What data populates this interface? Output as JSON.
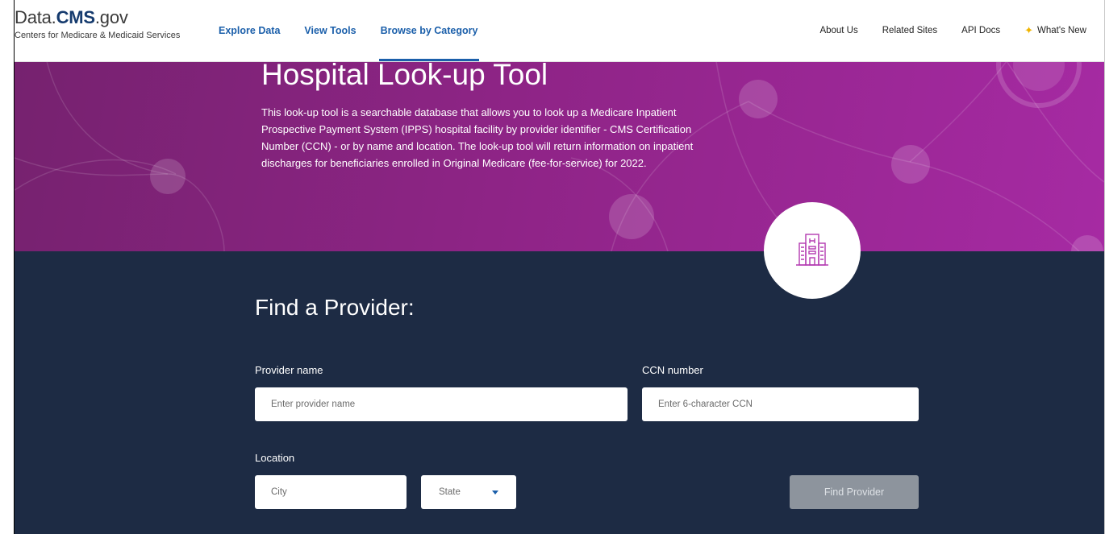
{
  "header": {
    "logo": {
      "prefix": "Data.",
      "brand": "CMS",
      "suffix": ".gov",
      "subtitle": "Centers for Medicare & Medicaid Services"
    },
    "nav": [
      {
        "label": "Explore Data",
        "active": false
      },
      {
        "label": "View Tools",
        "active": false
      },
      {
        "label": "Browse by Category",
        "active": true
      }
    ],
    "utility": [
      {
        "label": "About Us"
      },
      {
        "label": "Related Sites"
      },
      {
        "label": "API Docs"
      },
      {
        "label": "What's New",
        "icon": "sparkle-icon"
      }
    ]
  },
  "hero": {
    "title": "Hospital Look-up Tool",
    "description": "This look-up tool is a searchable database that allows you to look up a Medicare Inpatient Prospective Payment System (IPPS) hospital facility by provider identifier - CMS Certification Number (CCN) - or by name and location. The look-up tool will return information on inpatient discharges for beneficiaries enrolled in Original Medicare (fee-for-service) for 2022.",
    "badge_icon": "hospital-building-icon"
  },
  "form": {
    "title": "Find a Provider:",
    "provider_name": {
      "label": "Provider name",
      "placeholder": "Enter provider name",
      "value": ""
    },
    "ccn": {
      "label": "CCN number",
      "placeholder": "Enter 6-character CCN",
      "value": ""
    },
    "location": {
      "label": "Location",
      "city": {
        "placeholder": "City",
        "value": ""
      },
      "state": {
        "selected": "State"
      }
    },
    "submit_label": "Find Provider"
  },
  "colors": {
    "nav_link": "#1b5faa",
    "hero_purple": "#8e2486",
    "dark_navy": "#1d2b44",
    "badge_icon": "#b33ab1",
    "button_disabled": "#8d949d"
  }
}
